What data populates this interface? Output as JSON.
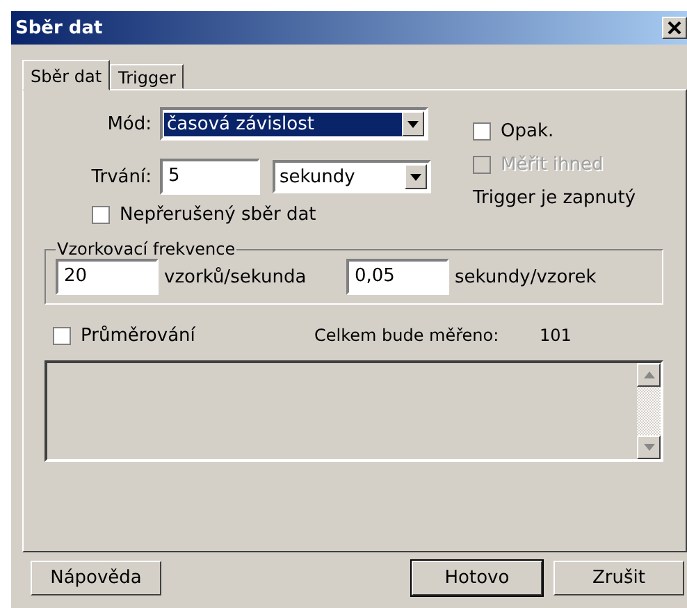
{
  "window": {
    "title": "Sběr dat"
  },
  "tabs": [
    {
      "label": "Sběr dat",
      "selected": true
    },
    {
      "label": "Trigger",
      "selected": false
    }
  ],
  "mode": {
    "label": "Mód:",
    "value": "časová závislost",
    "highlighted": true
  },
  "duration": {
    "label": "Trvání:",
    "value": "5",
    "unit": "sekundy"
  },
  "options": [
    {
      "label": "Opak.",
      "checked": false,
      "disabled": false
    },
    {
      "label": "Měřit ihned",
      "checked": false,
      "disabled": true
    }
  ],
  "trigger_status": "Trigger je zapnutý",
  "continuous": {
    "label": "Nepřerušený sběr dat",
    "checked": false
  },
  "sampling": {
    "legend": "Vzorkovací frekvence",
    "rate": "20",
    "rate_unit": "vzorků/sekunda",
    "period": "0,05",
    "period_unit": "sekundy/vzorek"
  },
  "averaging": {
    "label": "Průměrování",
    "checked": false
  },
  "total": {
    "label": "Celkem bude měřeno:",
    "value": "101"
  },
  "buttons": [
    {
      "label": "Nápověda",
      "default": false
    },
    {
      "label": "Hotovo",
      "default": true
    },
    {
      "label": "Zrušit",
      "default": false
    }
  ]
}
